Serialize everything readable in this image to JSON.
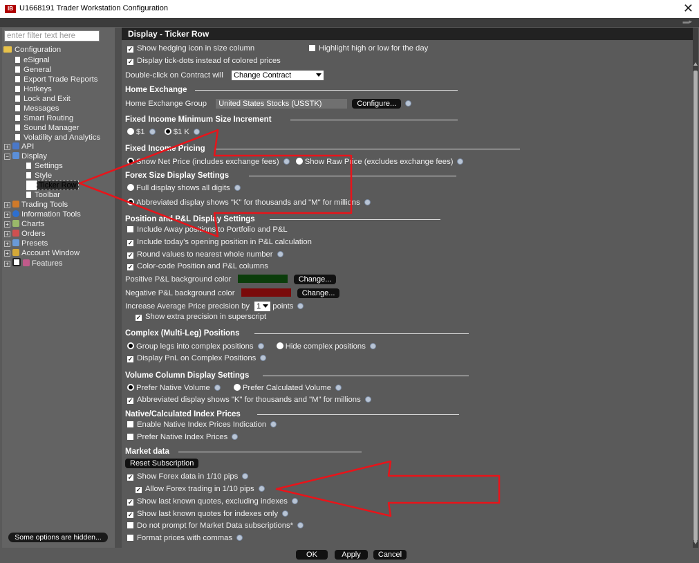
{
  "window": {
    "app_badge": "IB",
    "title": "U1668191 Trader Workstation Configuration",
    "close_glyph": "✕"
  },
  "sidebar": {
    "filter_placeholder": "enter filter text here",
    "items": [
      {
        "label": "Configuration"
      },
      {
        "label": "eSignal"
      },
      {
        "label": "General"
      },
      {
        "label": "Export Trade Reports"
      },
      {
        "label": "Hotkeys"
      },
      {
        "label": "Lock and Exit"
      },
      {
        "label": "Messages"
      },
      {
        "label": "Smart Routing"
      },
      {
        "label": "Sound Manager"
      },
      {
        "label": "Volatility and Analytics"
      },
      {
        "label": "API"
      },
      {
        "label": "Display"
      },
      {
        "label": "Settings"
      },
      {
        "label": "Style"
      },
      {
        "label": "Ticker Row"
      },
      {
        "label": "Toolbar"
      },
      {
        "label": "Trading Tools"
      },
      {
        "label": "Information Tools"
      },
      {
        "label": "Charts"
      },
      {
        "label": "Orders"
      },
      {
        "label": "Presets"
      },
      {
        "label": "Account Window"
      },
      {
        "label": "Features"
      }
    ],
    "hidden_button": "Some options are hidden..."
  },
  "panel": {
    "title": "Display - Ticker Row",
    "hedging_icon": "Show hedging icon in size column",
    "highlight_high_low": "Highlight high or low for the day",
    "tick_dots": "Display tick-dots instead of colored prices",
    "double_click_label": "Double-click on Contract will",
    "double_click_value": "Change Contract",
    "home_exchange": {
      "title": "Home Exchange",
      "group_label": "Home Exchange Group",
      "group_value": "United States Stocks (USSTK)",
      "configure": "Configure..."
    },
    "fixed_income_min": {
      "title": "Fixed Income Minimum Size Increment",
      "opt1": "$1",
      "opt2": "$1 K"
    },
    "fixed_income_pricing": {
      "title": "Fixed Income Pricing",
      "net": "Show Net Price (includes exchange fees)",
      "raw": "Show Raw Price (excludes exchange fees)"
    },
    "forex_size": {
      "title": "Forex Size Display Settings",
      "full": "Full display shows all digits",
      "abbrev": "Abbreviated display shows \"K\" for thousands and \"M\" for millions"
    },
    "position_pl": {
      "title": "Position and P&L Display Settings",
      "away": "Include Away positions to Portfolio and P&L",
      "opening": "Include today's opening position in P&L calculation",
      "round": "Round values to nearest whole number",
      "color_code": "Color-code Position and P&L columns",
      "positive_label": "Positive P&L background color",
      "negative_label": "Negative P&L background color",
      "change": "Change...",
      "avg_price_label": "Increase Average Price precision by",
      "avg_price_value": "1",
      "avg_price_unit": "points",
      "superscript": "Show extra precision in superscript",
      "positive_color": "#0b3d0b",
      "negative_color": "#7a0a0a"
    },
    "complex": {
      "title": "Complex (Multi-Leg) Positions",
      "group": "Group legs into complex positions",
      "hide": "Hide complex positions",
      "pnl": "Display PnL on Complex Positions"
    },
    "volume": {
      "title": "Volume Column Display Settings",
      "native": "Prefer Native Volume",
      "calc": "Prefer Calculated Volume",
      "abbrev": "Abbreviated display shows \"K\" for thousands and \"M\" for millions"
    },
    "index_prices": {
      "title": "Native/Calculated Index Prices",
      "enable": "Enable Native Index Prices Indication",
      "prefer": "Prefer Native Index Prices"
    },
    "market_data": {
      "title": "Market data",
      "reset": "Reset Subscription",
      "forex_pips": "Show Forex data in 1/10 pips",
      "allow_forex": "Allow Forex trading in 1/10 pips",
      "last_excl": "Show last known quotes, excluding indexes",
      "last_idx": "Show last known quotes for indexes only",
      "no_prompt": "Do not prompt for Market Data subscriptions*",
      "commas": "Format prices with commas"
    }
  },
  "footer": {
    "ok": "OK",
    "apply": "Apply",
    "cancel": "Cancel"
  },
  "colors": {
    "annotation_red": "#e8141a"
  }
}
